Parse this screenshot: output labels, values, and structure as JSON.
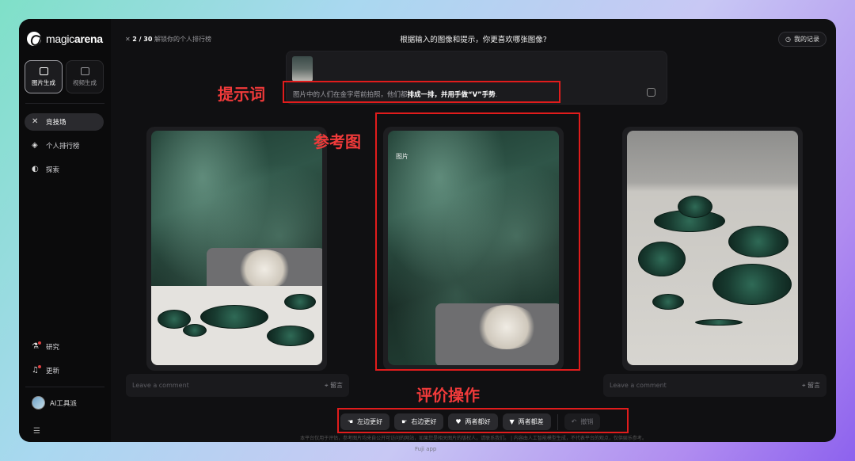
{
  "brand": {
    "name_prefix": "magic",
    "name_suffix": "arena"
  },
  "sidebar": {
    "modes": [
      {
        "label": "图片生成",
        "icon": "image-icon",
        "active": true
      },
      {
        "label": "视频生成",
        "icon": "video-icon",
        "active": false
      }
    ],
    "nav": [
      {
        "label": "竞技场",
        "icon": "arena-icon",
        "active": true
      },
      {
        "label": "个人排行榜",
        "icon": "leaderboard-icon",
        "active": false
      },
      {
        "label": "探索",
        "icon": "planet-icon",
        "active": false
      }
    ],
    "bottom_nav": [
      {
        "label": "研究",
        "icon": "research-icon",
        "badge": true
      },
      {
        "label": "更新",
        "icon": "bell-icon",
        "badge": true
      }
    ],
    "user": {
      "name": "AI工具派"
    }
  },
  "header": {
    "progress_current": "2 / 30",
    "progress_text": "解锁你的个人排行榜",
    "question": "根据输入的图像和提示，你更喜欢哪张图像?",
    "records_label": "我的记录"
  },
  "prompt": {
    "text_before": "图片中的人们在金字塔前拍照，他们都",
    "text_bold": "排成一排，并用手做“V”手势",
    "text_after": "."
  },
  "reference_tag": "图片",
  "comments": {
    "placeholder": "Leave a comment",
    "send_label": "留言"
  },
  "actions": [
    {
      "label": "左边更好",
      "icon": "point-left-icon"
    },
    {
      "label": "右边更好",
      "icon": "point-right-icon"
    },
    {
      "label": "两者都好",
      "icon": "thumbs-up-icon"
    },
    {
      "label": "两者都差",
      "icon": "thumbs-down-icon"
    }
  ],
  "undo_label": "撤销",
  "disclaimer": "本平台仅用于评估，参考图片均来自公开可访问的网站，如果您是相关图片的版权人，请联系我们。 | 内容由人工智能模型生成，不代表平台的观点，仅供娱乐参考。",
  "annotations": {
    "prompt": "提示词",
    "reference": "参考图",
    "actions": "评价操作"
  },
  "watermark": "Fuji app",
  "colors": {
    "annotation": "#e11c1c",
    "window_bg": "#101012",
    "sidebar_bg": "#0b0b0c"
  }
}
